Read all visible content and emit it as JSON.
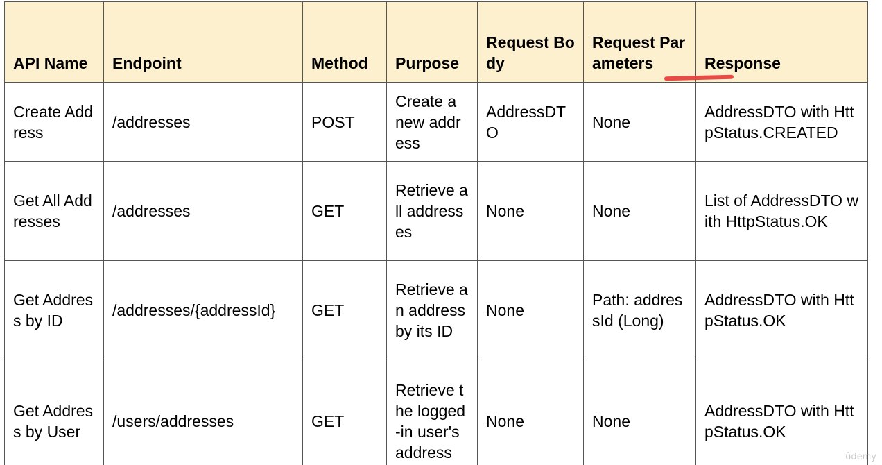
{
  "table": {
    "headers": {
      "api_name": "API Name",
      "endpoint": "Endpoint",
      "method": "Method",
      "purpose": "Purpose",
      "request_body": "Request Body",
      "request_parameters": "Request Parameters",
      "response": "Response"
    },
    "rows": [
      {
        "api_name": "Create Address",
        "endpoint": "/addresses",
        "method": "POST",
        "purpose": "Create a new address",
        "request_body": "AddressDTO",
        "request_parameters": "None",
        "response": "AddressDTO with HttpStatus.CREATED"
      },
      {
        "api_name": "Get All Addresses",
        "endpoint": "/addresses",
        "method": "GET",
        "purpose": "Retrieve all addresses",
        "request_body": "None",
        "request_parameters": "None",
        "response": "List of AddressDTO with HttpStatus.OK"
      },
      {
        "api_name": "Get Address by ID",
        "endpoint": "/addresses/{addressId}",
        "method": "GET",
        "purpose": "Retrieve an address by its ID",
        "request_body": "None",
        "request_parameters": "Path: addressId (Long)",
        "response": "AddressDTO with HttpStatus.OK"
      },
      {
        "api_name": "Get Address by User",
        "endpoint": "/users/addresses",
        "method": "GET",
        "purpose": "Retrieve the logged-in user's address",
        "request_body": "None",
        "request_parameters": "None",
        "response": "AddressDTO with HttpStatus.OK"
      }
    ]
  },
  "watermark": "ûdemy",
  "annotation_color": "#e53935",
  "header_background": "#fdf0cf"
}
